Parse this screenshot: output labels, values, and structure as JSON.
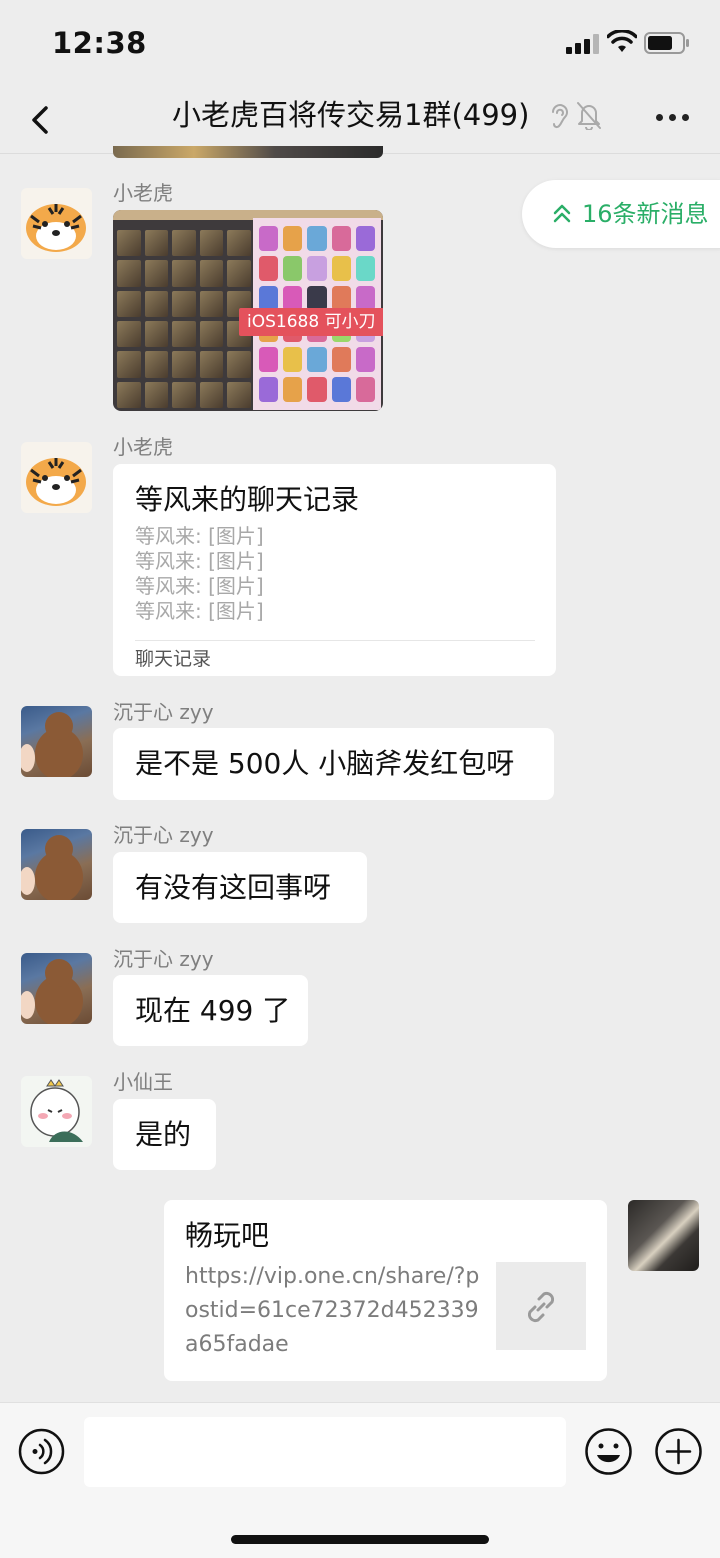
{
  "status_bar": {
    "time": "12:38",
    "icons": [
      "cellular-signal-icon",
      "wifi-icon",
      "battery-icon"
    ]
  },
  "nav": {
    "title": "小老虎百将传交易1群(499)",
    "icons": [
      "back-arrow-icon",
      "ear-icon",
      "mute-bell-icon",
      "more-dots-icon"
    ]
  },
  "new_messages_pill": {
    "label": "16条新消息",
    "color": "#2aae67"
  },
  "messages": [
    {
      "sender": "小老虎",
      "avatar": "tiger-avatar",
      "type": "image",
      "image_overlay_text": "iOS1688 可小刀"
    },
    {
      "sender": "小老虎",
      "avatar": "tiger-avatar",
      "type": "chat-record",
      "title": "等风来的聊天记录",
      "lines": [
        "等风来: [图片]",
        "等风来: [图片]",
        "等风来: [图片]",
        "等风来: [图片]"
      ],
      "footer": "聊天记录"
    },
    {
      "sender": "沉于心 zyy",
      "avatar": "bear-avatar",
      "type": "text",
      "text": "是不是 500人 小脑斧发红包呀"
    },
    {
      "sender": "沉于心 zyy",
      "avatar": "bear-avatar",
      "type": "text",
      "text": "有没有这回事呀"
    },
    {
      "sender": "沉于心 zyy",
      "avatar": "bear-avatar",
      "type": "text",
      "text": "现在 499 了"
    },
    {
      "sender": "小仙王",
      "avatar": "fairy-king-avatar",
      "type": "text",
      "text": "是的"
    },
    {
      "sender": "self",
      "avatar": "self-avatar",
      "type": "link",
      "title": "畅玩吧",
      "url": "https://vip.one.cn/share/?postid=61ce72372d452339a65fadae",
      "thumb_icon": "link-icon"
    }
  ],
  "input_bar": {
    "placeholder": "",
    "icons": [
      "voice-icon",
      "emoji-icon",
      "plus-icon"
    ]
  },
  "colors": {
    "background": "#ededed",
    "bubble": "#ffffff",
    "accent_green": "#2aae67",
    "sender_gray": "#7f7f7f"
  }
}
